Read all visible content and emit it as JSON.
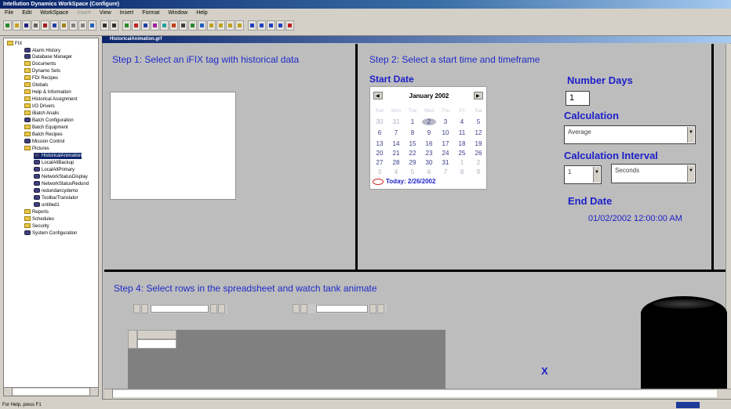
{
  "window": {
    "title": "Intellution Dynamics WorkSpace (Configure)"
  },
  "menu": [
    "File",
    "Edit",
    "WorkSpace",
    "Insert",
    "View",
    "Insert",
    "Format",
    "Window",
    "Help"
  ],
  "tree": {
    "items": [
      {
        "label": "FIX",
        "icon": "folder-icon",
        "level": 0
      },
      {
        "label": "Alarm History",
        "icon": "gear-icon",
        "level": 1
      },
      {
        "label": "Database Manager",
        "icon": "gear-icon",
        "level": 1
      },
      {
        "label": "Documents",
        "icon": "folder-icon",
        "level": 1
      },
      {
        "label": "Dynamo Sets",
        "icon": "folder-icon",
        "level": 1
      },
      {
        "label": "FDI Recipes",
        "icon": "folder-icon",
        "level": 1
      },
      {
        "label": "Globals",
        "icon": "folder-icon",
        "level": 1
      },
      {
        "label": "Help & Information",
        "icon": "folder-icon",
        "level": 1
      },
      {
        "label": "Historical Assignment",
        "icon": "folder-icon",
        "level": 1
      },
      {
        "label": "I/O Drivers",
        "icon": "folder-icon",
        "level": 1
      },
      {
        "label": "iBatch Analis",
        "icon": "folder-icon",
        "level": 1
      },
      {
        "label": "Batch Configuration",
        "icon": "gear-icon",
        "level": 1
      },
      {
        "label": "Batch Equipment",
        "icon": "folder-icon",
        "level": 1
      },
      {
        "label": "Batch Recipes",
        "icon": "folder-icon",
        "level": 1
      },
      {
        "label": "Mission Control",
        "icon": "gear-icon",
        "level": 1
      },
      {
        "label": "Pictures",
        "icon": "folder-icon",
        "level": 1
      },
      {
        "label": "HistoricalAnimation",
        "icon": "gear-icon",
        "level": 2,
        "selected": true
      },
      {
        "label": "LocalAltBackup",
        "icon": "gear-icon",
        "level": 2
      },
      {
        "label": "LocalAltPrimary",
        "icon": "gear-icon",
        "level": 2
      },
      {
        "label": "NetworkStatusDisplay",
        "icon": "gear-icon",
        "level": 2
      },
      {
        "label": "NetworkStatusRedund",
        "icon": "gear-icon",
        "level": 2
      },
      {
        "label": "redundancydemo",
        "icon": "gear-icon",
        "level": 2
      },
      {
        "label": "ToolbarTranslator",
        "icon": "gear-icon",
        "level": 2
      },
      {
        "label": "untitled1",
        "icon": "gear-icon",
        "level": 2
      },
      {
        "label": "Reports",
        "icon": "folder-icon",
        "level": 1
      },
      {
        "label": "Schedules",
        "icon": "folder-icon",
        "level": 1
      },
      {
        "label": "Security",
        "icon": "folder-icon",
        "level": 1
      },
      {
        "label": "System Configuration",
        "icon": "gear-icon",
        "level": 1
      }
    ]
  },
  "document": {
    "title": "HistoricalAnimation.grf"
  },
  "step1": {
    "heading": "Step 1: Select an iFIX tag with historical data"
  },
  "step2": {
    "heading": "Step 2: Select a start time and timeframe",
    "start_date_label": "Start Date",
    "calendar": {
      "month": "January 2002",
      "weekdays": [
        "Sun",
        "Mon",
        "Tue",
        "Wed",
        "Thu",
        "Fri",
        "Sat"
      ],
      "weeks": [
        [
          "30",
          "31",
          "1",
          "2",
          "3",
          "4",
          "5"
        ],
        [
          "6",
          "7",
          "8",
          "9",
          "10",
          "11",
          "12"
        ],
        [
          "13",
          "14",
          "15",
          "16",
          "17",
          "18",
          "19"
        ],
        [
          "20",
          "21",
          "22",
          "23",
          "24",
          "25",
          "26"
        ],
        [
          "27",
          "28",
          "29",
          "30",
          "31",
          "1",
          "2"
        ],
        [
          "3",
          "4",
          "5",
          "6",
          "7",
          "8",
          "9"
        ]
      ],
      "today_label": "Today: 2/26/2002"
    },
    "number_days_label": "Number Days",
    "number_days_value": "1",
    "calculation_label": "Calculation",
    "calculation_value": "Average",
    "interval_label": "Calculation Interval",
    "interval_value": "1",
    "interval_unit": "Seconds",
    "end_date_label": "End Date",
    "end_date_value": "01/02/2002 12:00:00 AM"
  },
  "step4": {
    "heading": "Step 4: Select rows in the spreadsheet and watch tank animate",
    "marker": "X"
  },
  "status": {
    "text": "For Help, press F1"
  }
}
